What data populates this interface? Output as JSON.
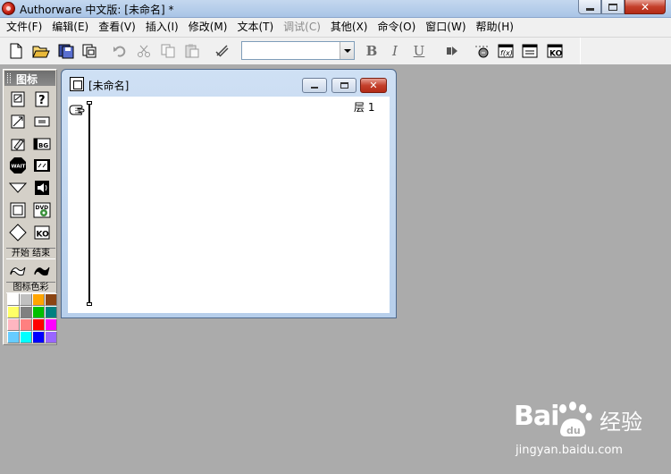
{
  "app": {
    "title": "Authorware 中文版: [未命名] *"
  },
  "menu": [
    {
      "label": "文件(F)",
      "disabled": false
    },
    {
      "label": "编辑(E)",
      "disabled": false
    },
    {
      "label": "查看(V)",
      "disabled": false
    },
    {
      "label": "插入(I)",
      "disabled": false
    },
    {
      "label": "修改(M)",
      "disabled": false
    },
    {
      "label": "文本(T)",
      "disabled": false
    },
    {
      "label": "调试(C)",
      "disabled": true
    },
    {
      "label": "其他(X)",
      "disabled": false
    },
    {
      "label": "命令(O)",
      "disabled": false
    },
    {
      "label": "窗口(W)",
      "disabled": false
    },
    {
      "label": "帮助(H)",
      "disabled": false
    }
  ],
  "toolbar": {
    "style_value": "",
    "bold": "B",
    "italic": "I",
    "underline": "U"
  },
  "palette": {
    "title": "图标",
    "start_end_label": "开始  结束",
    "color_label": "图标色彩",
    "colors": [
      "#ffffff",
      "#c0c0c0",
      "#ffa500",
      "#8b4513",
      "#ffff66",
      "#808080",
      "#00c000",
      "#008080",
      "#ffb6c1",
      "#ff8080",
      "#ff0000",
      "#ff00ff",
      "#66ccff",
      "#00ffff",
      "#0000ff",
      "#9966ff"
    ]
  },
  "design_window": {
    "title": "[未命名]",
    "layer_label": "层  1"
  },
  "watermark": {
    "logo": "Bai",
    "brand": "经验",
    "url": "jingyan.baidu.com"
  },
  "colors": {
    "desktop": "#ababab",
    "chrome": "#f0f0f0",
    "palette": "#d4d0c8"
  }
}
